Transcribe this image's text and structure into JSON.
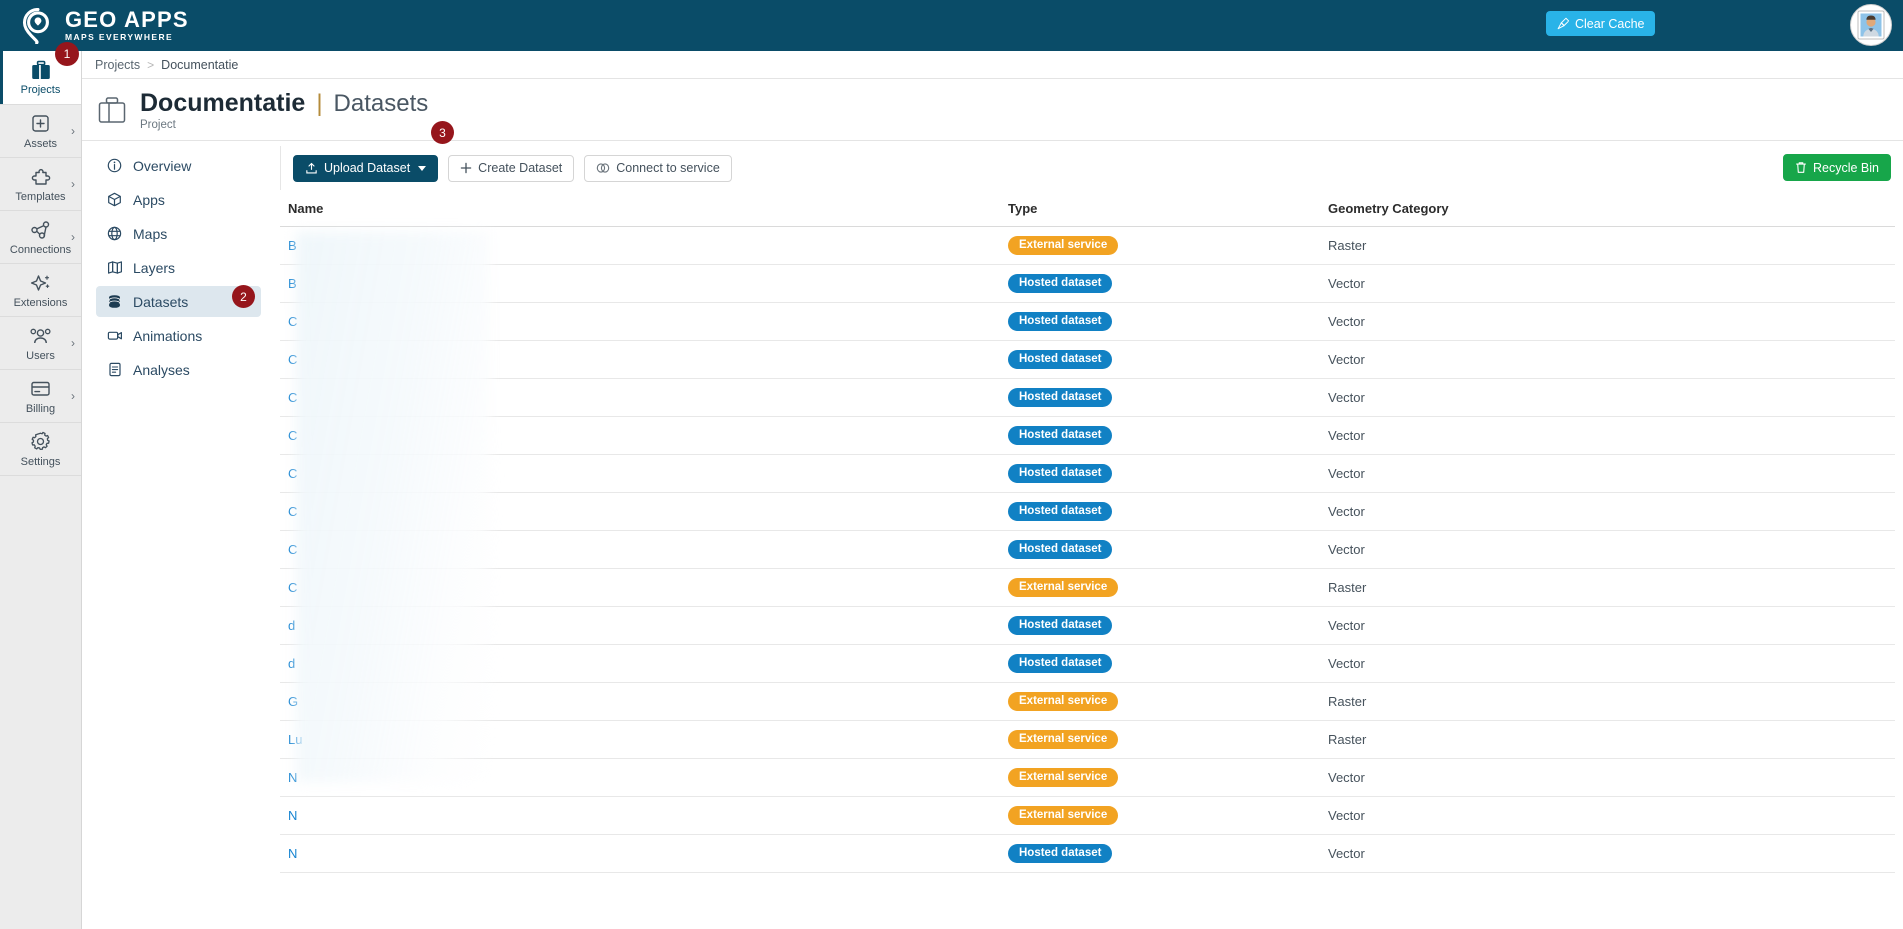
{
  "topbar": {
    "brand_title": "GEO APPS",
    "brand_subtitle": "MAPS EVERYWHERE",
    "clear_cache_label": "Clear Cache",
    "clear_cache_icon": "broom-icon",
    "avatar_icon": "user-avatar-photo"
  },
  "rail": {
    "items": [
      {
        "label": "Projects",
        "icon": "briefcase-icon",
        "active": true,
        "chevron": false,
        "badge": "1"
      },
      {
        "label": "Assets",
        "icon": "plus-box-icon",
        "active": false,
        "chevron": true
      },
      {
        "label": "Templates",
        "icon": "puzzle-icon",
        "active": false,
        "chevron": true
      },
      {
        "label": "Connections",
        "icon": "nodes-icon",
        "active": false,
        "chevron": true
      },
      {
        "label": "Extensions",
        "icon": "sparkle-icon",
        "active": false,
        "chevron": false
      },
      {
        "label": "Users",
        "icon": "people-icon",
        "active": false,
        "chevron": true
      },
      {
        "label": "Billing",
        "icon": "credit-card-icon",
        "active": false,
        "chevron": true
      },
      {
        "label": "Settings",
        "icon": "gear-icon",
        "active": false,
        "chevron": false
      }
    ]
  },
  "breadcrumb": {
    "root": "Projects",
    "separator": ">",
    "current": "Documentatie"
  },
  "page_header": {
    "icon": "briefcase-icon",
    "project": "Documentatie",
    "divider": "|",
    "section": "Datasets",
    "subtitle": "Project"
  },
  "subnav": {
    "items": [
      {
        "label": "Overview",
        "icon": "info-circle-icon",
        "active": false
      },
      {
        "label": "Apps",
        "icon": "cube-icon",
        "active": false
      },
      {
        "label": "Maps",
        "icon": "globe-icon",
        "active": false
      },
      {
        "label": "Layers",
        "icon": "layers-icon",
        "active": false
      },
      {
        "label": "Datasets",
        "icon": "database-icon",
        "active": true,
        "badge": "2"
      },
      {
        "label": "Animations",
        "icon": "video-icon",
        "active": false
      },
      {
        "label": "Analyses",
        "icon": "document-icon",
        "active": false
      }
    ]
  },
  "toolbar": {
    "upload_label": "Upload Dataset",
    "upload_icon": "upload-icon",
    "upload_has_caret": true,
    "create_label": "Create Dataset",
    "create_icon": "plus-icon",
    "connect_label": "Connect to service",
    "connect_icon": "link-icon",
    "recycle_label": "Recycle Bin",
    "recycle_icon": "trash-icon",
    "marker_3": "3"
  },
  "table": {
    "headers": [
      "Name",
      "Type",
      "Geometry Category"
    ],
    "name_redacted": true,
    "rows": [
      {
        "name": "B",
        "type": "External service",
        "type_kind": "external",
        "geometry": "Raster"
      },
      {
        "name": "B",
        "type": "Hosted dataset",
        "type_kind": "hosted",
        "geometry": "Vector"
      },
      {
        "name": "C",
        "type": "Hosted dataset",
        "type_kind": "hosted",
        "geometry": "Vector"
      },
      {
        "name": "C",
        "type": "Hosted dataset",
        "type_kind": "hosted",
        "geometry": "Vector"
      },
      {
        "name": "C",
        "type": "Hosted dataset",
        "type_kind": "hosted",
        "geometry": "Vector"
      },
      {
        "name": "C",
        "type": "Hosted dataset",
        "type_kind": "hosted",
        "geometry": "Vector"
      },
      {
        "name": "C",
        "type": "Hosted dataset",
        "type_kind": "hosted",
        "geometry": "Vector"
      },
      {
        "name": "C",
        "type": "Hosted dataset",
        "type_kind": "hosted",
        "geometry": "Vector"
      },
      {
        "name": "C",
        "type": "Hosted dataset",
        "type_kind": "hosted",
        "geometry": "Vector"
      },
      {
        "name": "C",
        "type": "External service",
        "type_kind": "external",
        "geometry": "Raster"
      },
      {
        "name": "d",
        "type": "Hosted dataset",
        "type_kind": "hosted",
        "geometry": "Vector"
      },
      {
        "name": "d",
        "type": "Hosted dataset",
        "type_kind": "hosted",
        "geometry": "Vector"
      },
      {
        "name": "G",
        "type": "External service",
        "type_kind": "external",
        "geometry": "Raster"
      },
      {
        "name": "Lu",
        "type": "External service",
        "type_kind": "external",
        "geometry": "Raster"
      },
      {
        "name": "N",
        "type": "External service",
        "type_kind": "external",
        "geometry": "Vector"
      },
      {
        "name": "N",
        "type": "External service",
        "type_kind": "external",
        "geometry": "Vector"
      },
      {
        "name": "N",
        "type": "Hosted dataset",
        "type_kind": "hosted",
        "geometry": "Vector"
      }
    ]
  },
  "colors": {
    "header_bg": "#0a4c68",
    "accent_cyan": "#29b3e8",
    "badge_hosted": "#1181c4",
    "badge_external": "#f2a322",
    "green": "#17a64a",
    "marker_red": "#96161c",
    "link_blue": "#1784d1"
  }
}
